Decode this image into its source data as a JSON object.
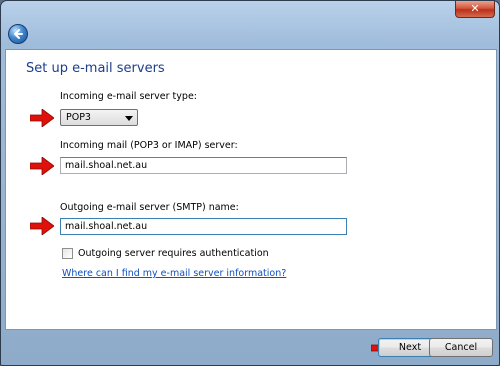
{
  "window": {
    "close_glyph": "✕"
  },
  "page": {
    "heading": "Set up e-mail servers"
  },
  "incoming_type": {
    "label": "Incoming e-mail server type:",
    "selected": "POP3"
  },
  "incoming_server": {
    "label": "Incoming mail (POP3 or IMAP) server:",
    "value": "mail.shoal.net.au"
  },
  "outgoing_server": {
    "label": "Outgoing e-mail server (SMTP) name:",
    "value": "mail.shoal.net.au"
  },
  "auth_checkbox": {
    "label": "Outgoing server requires authentication",
    "checked": false
  },
  "help_link": {
    "label": "Where can I find my e-mail server information?"
  },
  "buttons": {
    "next": "Next",
    "cancel": "Cancel"
  },
  "colors": {
    "annotation_arrow": "#e0100b",
    "heading": "#1d3e8c",
    "link": "#0f4fc2"
  }
}
